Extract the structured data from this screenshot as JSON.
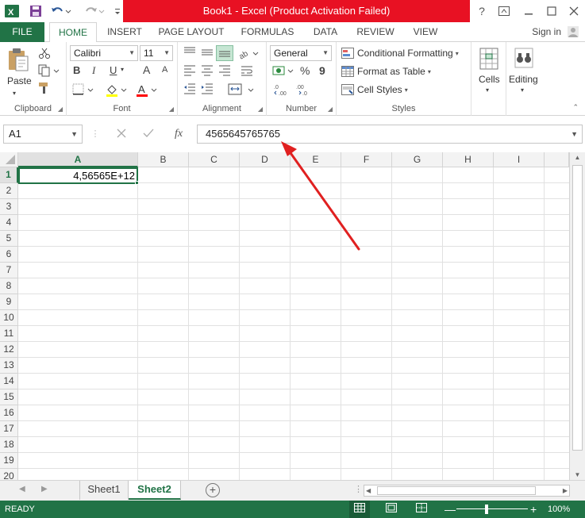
{
  "title": "Book1 -  Excel (Product Activation Failed)",
  "tabs": [
    "FILE",
    "HOME",
    "INSERT",
    "PAGE LAYOUT",
    "FORMULAS",
    "DATA",
    "REVIEW",
    "VIEW"
  ],
  "signin": "Sign in",
  "window_controls": {
    "help": "?",
    "restore_ribbon": "⬒",
    "minimize": "—",
    "maximize": "☐",
    "close": "✕"
  },
  "ribbon": {
    "clipboard": {
      "paste": "Paste",
      "label": "Clipboard"
    },
    "font": {
      "name": "Calibri",
      "size": "11",
      "label": "Font",
      "bold": "B",
      "italic": "I",
      "underline": "U",
      "grow": "A",
      "shrink": "A"
    },
    "alignment": {
      "label": "Alignment"
    },
    "number": {
      "format": "General",
      "percent": "%",
      "comma": "9",
      "label": "Number"
    },
    "styles": {
      "conditional": "Conditional Formatting",
      "format_table": "Format as Table",
      "cell_styles": "Cell Styles",
      "label": "Styles"
    },
    "cells": {
      "label": "Cells"
    },
    "editing": {
      "label": "Editing"
    }
  },
  "formula_bar": {
    "name_box": "A1",
    "fx": "fx",
    "value": "4565645765765"
  },
  "grid": {
    "columns": [
      "A",
      "B",
      "C",
      "D",
      "E",
      "F",
      "G",
      "H",
      "I"
    ],
    "rows": [
      "1",
      "2",
      "3",
      "4",
      "5",
      "6",
      "7",
      "8",
      "9",
      "10",
      "11",
      "12",
      "13",
      "14",
      "15",
      "16",
      "17",
      "18",
      "19",
      "20"
    ],
    "cell_a1": "4,56565E+12",
    "selected_cell": "A1"
  },
  "sheets": [
    "Sheet1",
    "Sheet2"
  ],
  "active_sheet": "Sheet2",
  "status": {
    "ready": "READY",
    "zoom": "100%",
    "zoom_minus": "—",
    "zoom_plus": "+"
  },
  "colors": {
    "accent": "#217346",
    "title_warning": "#e81123",
    "annotation_arrow": "#e02020"
  }
}
